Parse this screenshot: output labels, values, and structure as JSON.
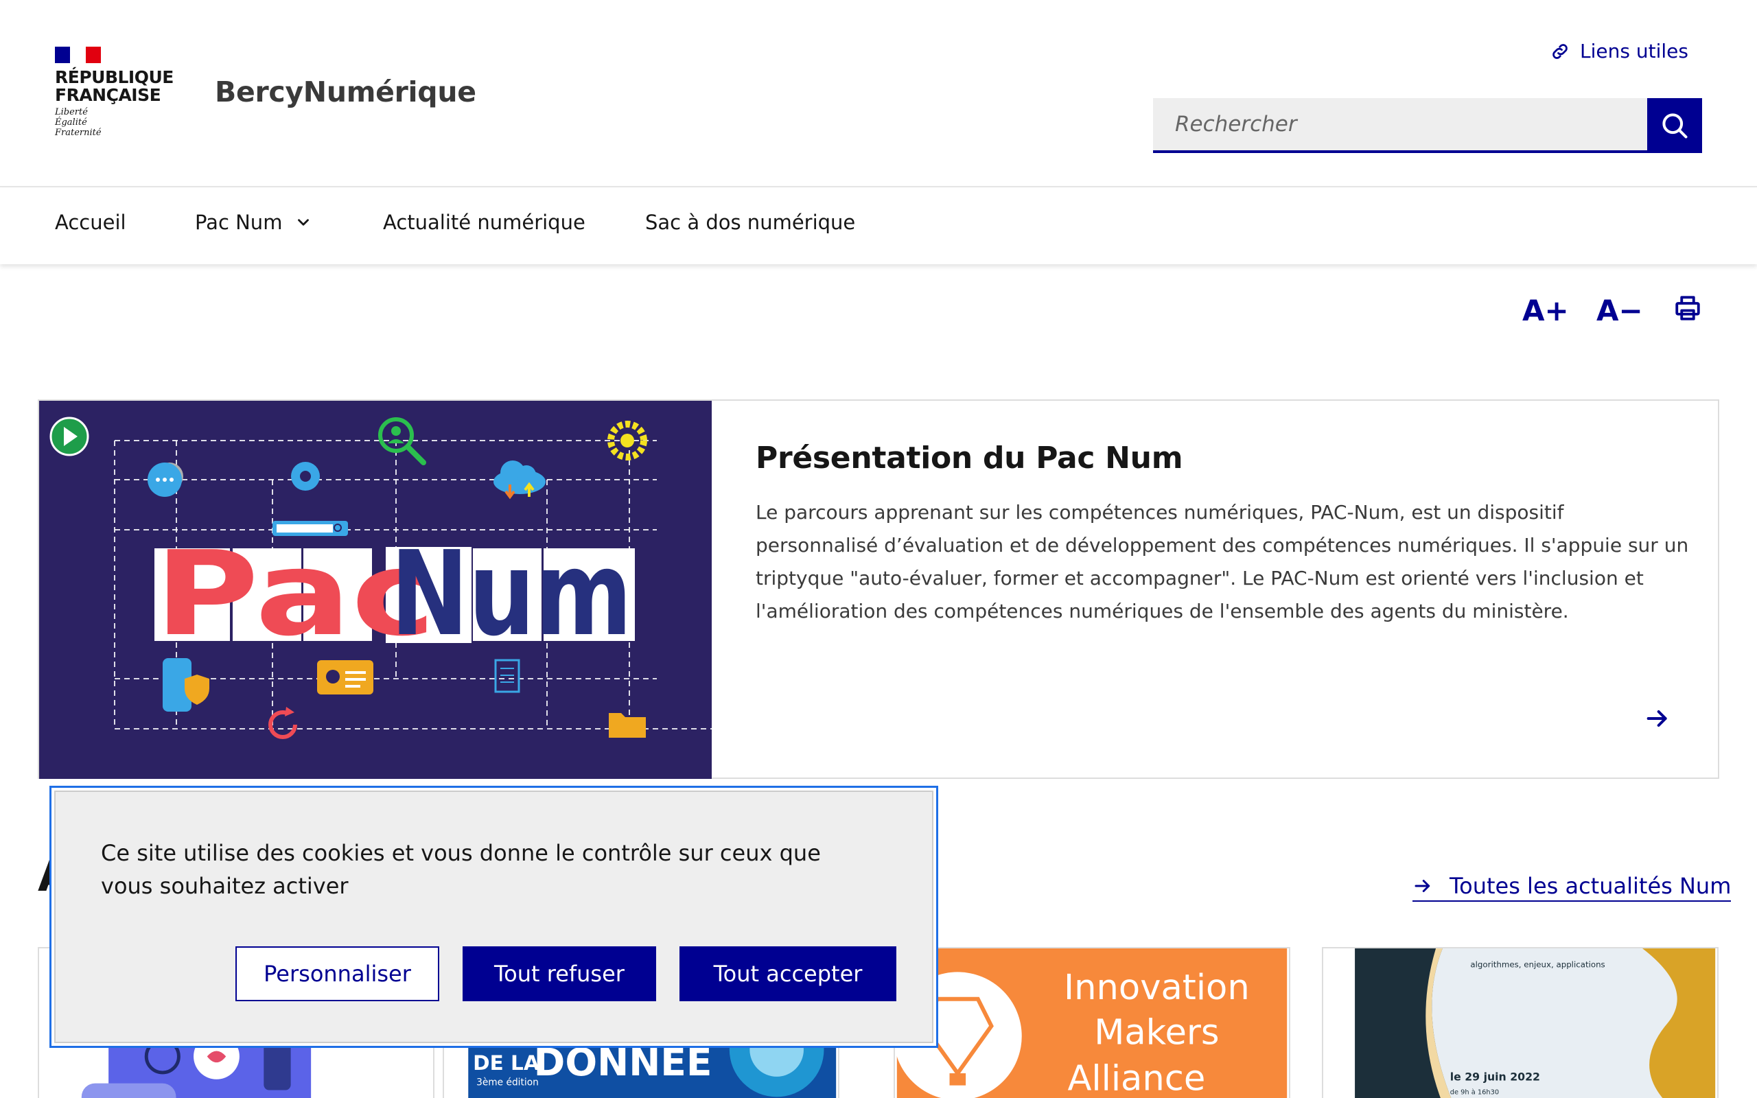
{
  "header": {
    "marianne": {
      "name_line1": "RÉPUBLIQUE",
      "name_line2": "FRANÇAISE",
      "devise1": "Liberté",
      "devise2": "Égalité",
      "devise3": "Fraternité"
    },
    "site_title": "BercyNumérique",
    "liens_utiles": "Liens utiles",
    "search": {
      "placeholder": "Rechercher"
    }
  },
  "nav": {
    "items": [
      {
        "label": "Accueil"
      },
      {
        "label": "Pac Num"
      },
      {
        "label": "Actualité numérique"
      },
      {
        "label": "Sac à dos numérique"
      }
    ]
  },
  "tools": {
    "increase": "A+",
    "decrease": "A−"
  },
  "feature": {
    "image_word_pac": "Pac",
    "image_word_num": "Num",
    "title": "Présentation du Pac Num",
    "text": "Le parcours apprenant sur les compétences numériques, PAC-Num, est un dispositif personnalisé d’évaluation et de développement des compétences numériques. Il s'appuie sur un triptyque \"auto-évaluer, former et accompagner\". Le PAC-Num est orienté vers l'inclusion et l'amélioration des compétences numériques de l'ensemble des agents du ministère."
  },
  "news": {
    "section_title_initial": "A",
    "all_link": "Toutes les actualités Num",
    "cards": [
      {
        "image_text": ""
      },
      {
        "image_text_1": "DE LA",
        "image_text_2": "DONNEE",
        "image_text_3": "3ème édition"
      },
      {
        "image_text_1": "Innovation",
        "image_text_2": "Makers",
        "image_text_3": "Alliance"
      },
      {
        "image_text_1": "algorithmes, enjeux, applications",
        "image_text_2": "le 29 juin 2022",
        "image_text_3": "de 9h à 16h30"
      }
    ]
  },
  "cookie": {
    "text": "Ce site utilise des cookies et vous donne le contrôle sur ceux que vous souhaitez activer",
    "personalize": "Personnaliser",
    "refuse_all": "Tout refuser",
    "accept_all": "Tout accepter"
  },
  "colors": {
    "primary": "#000091",
    "accent_red": "#e1000f",
    "pacnum_bg": "#2c2263",
    "pacnum_red": "#ef4b55",
    "pacnum_blue": "#26307e",
    "card_orange": "#f7893b",
    "focus_blue": "#1f6fe6"
  }
}
